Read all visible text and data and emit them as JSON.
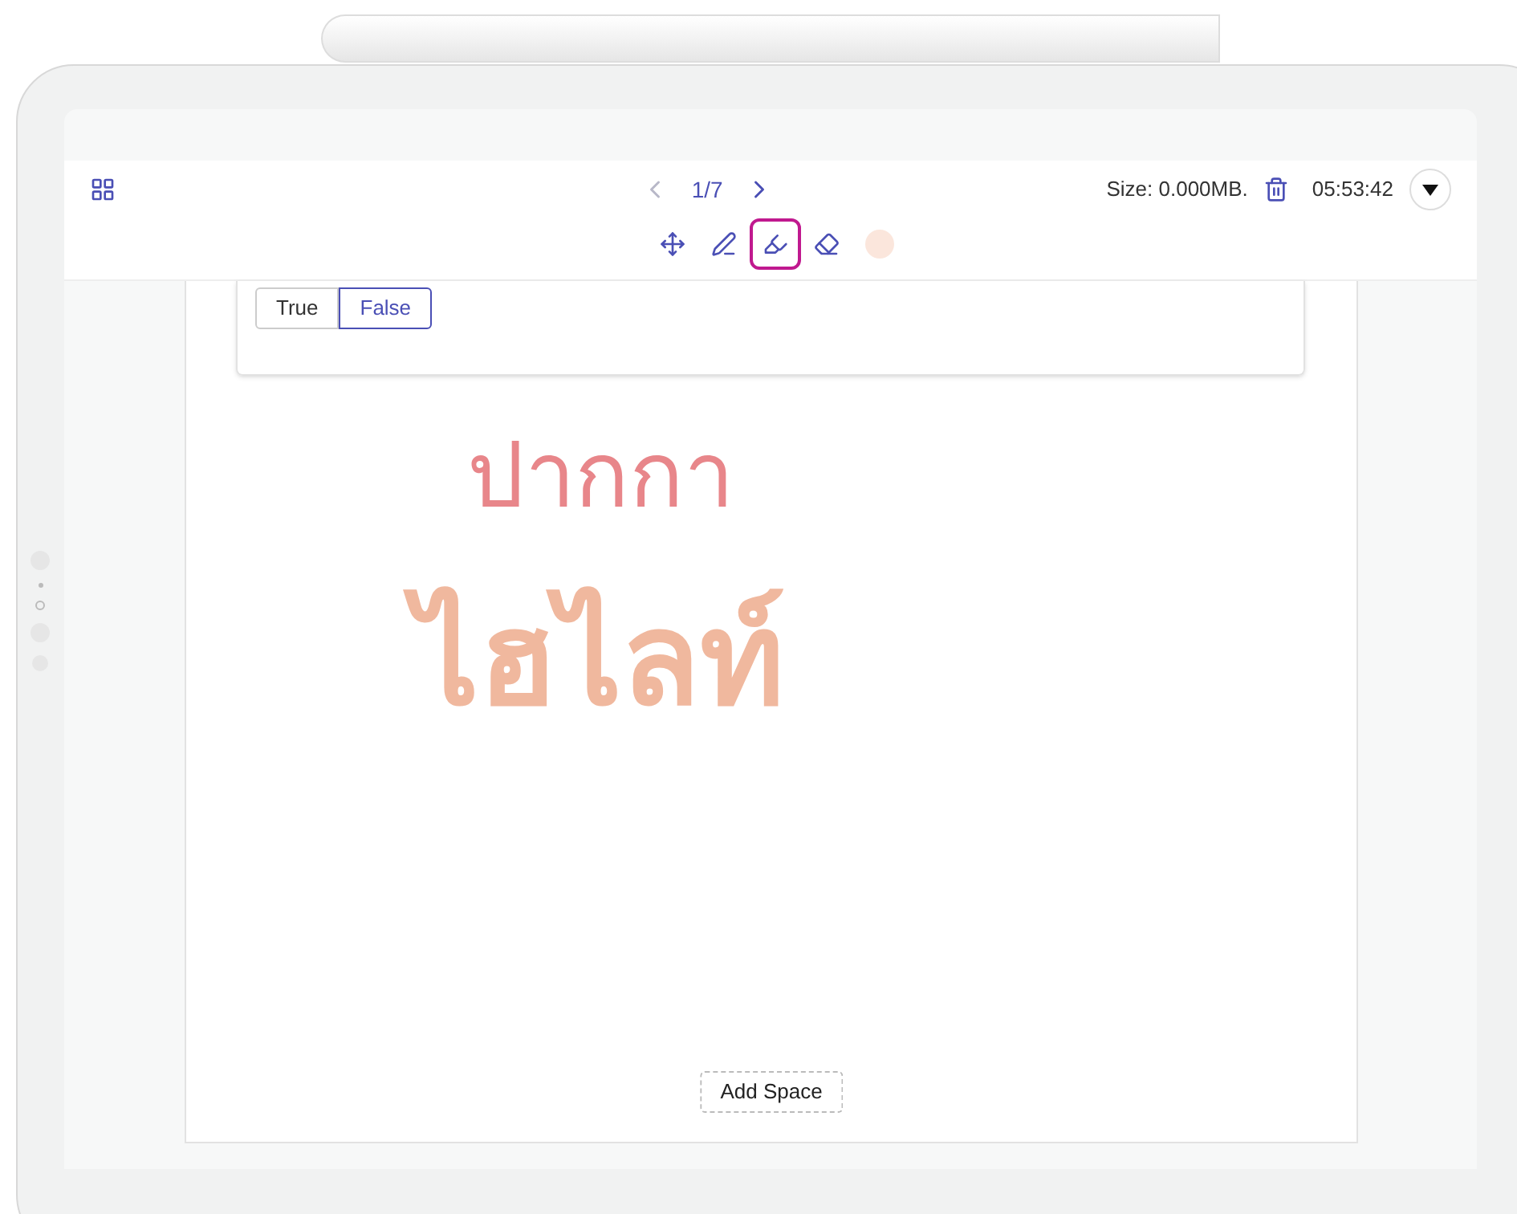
{
  "toolbar": {
    "page_indicator": "1/7",
    "size": "Size: 0.000MB.",
    "time": "05:53:42"
  },
  "tools": [
    {
      "kind": "move",
      "selected": false
    },
    {
      "kind": "pen",
      "selected": false
    },
    {
      "kind": "highlighter",
      "selected": true
    },
    {
      "kind": "eraser",
      "selected": false
    },
    {
      "kind": "color",
      "selected": false,
      "color": "#fbe6dc"
    }
  ],
  "answer_options": [
    {
      "label": "True",
      "selected": false
    },
    {
      "label": "False",
      "selected": true
    }
  ],
  "ink": [
    {
      "kind": "pen",
      "text": "ปากกา",
      "color": "#e8868a"
    },
    {
      "kind": "highlighter",
      "text": "ไฮไลท์",
      "color": "#f0b89e"
    }
  ],
  "add_space_button": "Add Space"
}
